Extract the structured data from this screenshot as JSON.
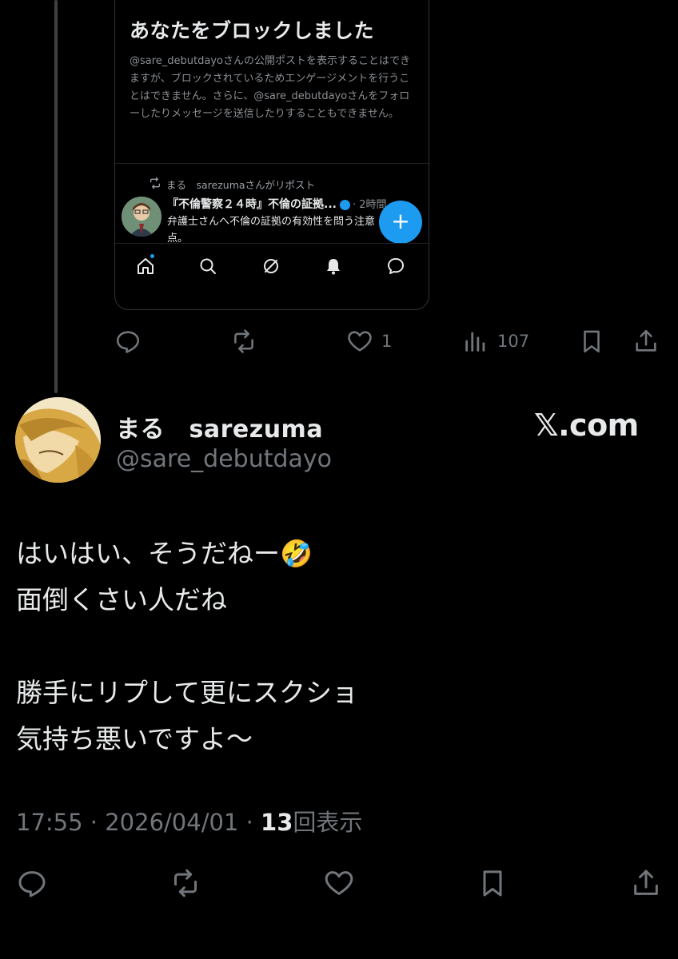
{
  "embed": {
    "title": "あなたをブロックしました",
    "body": "@sare_debutdayoさんの公開ポストを表示することはできますが、ブロックされているためエンゲージメントを行うことはできません。さらに、@sare_debutdayoさんをフォローしたりメッセージを送信したりすることもできません。",
    "repost_label": "まる　sarezumaさんがリポスト",
    "mini_post_title": "『不倫警察２４時』不倫の証拠...",
    "mini_post_time": "· 2時間",
    "mini_post_text": "弁護士さんへ不倫の証拠の有効性を問う注意点。",
    "fab_label": "+"
  },
  "actions": {
    "likes": "1",
    "views": "107"
  },
  "author": {
    "name": "まる　sarezuma",
    "handle": "@sare_debutdayo",
    "source": "𝕏.com"
  },
  "post": {
    "text": "はいはい、そうだねー🤣\n面倒くさい人だね\n\n勝手にリプして更にスクショ\n気持ち悪いですよ〜",
    "time": "17:55",
    "date": "2026/04/01",
    "views": "13",
    "views_label": "回表示"
  },
  "colors": {
    "accent": "#1d9bf0",
    "muted": "#71767b",
    "text": "#e7e9ea",
    "background": "#000000"
  }
}
